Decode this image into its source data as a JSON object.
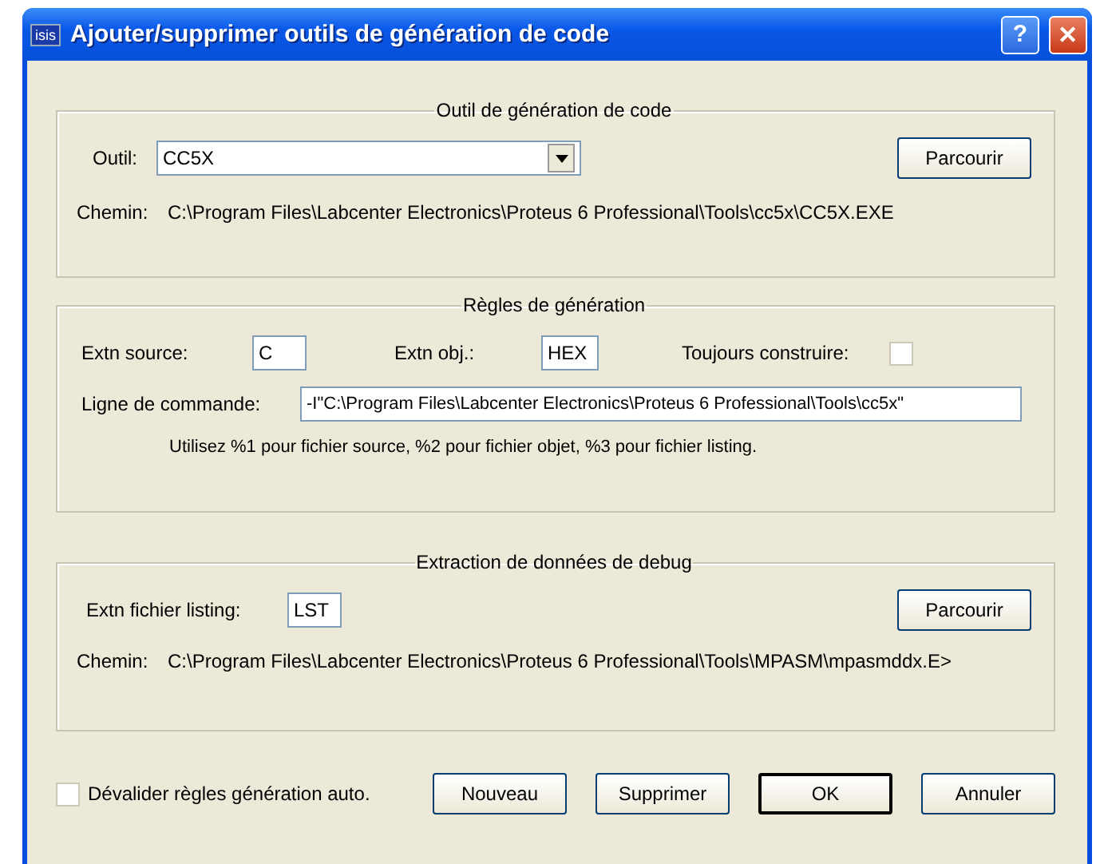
{
  "window": {
    "title": "Ajouter/supprimer outils de génération de code",
    "app_badge": "isis",
    "help_button": "?",
    "close_button": "✕"
  },
  "tool_group": {
    "title": "Outil de génération de code",
    "tool_label": "Outil:",
    "tool_value": "CC5X",
    "browse_button": "Parcourir",
    "path_label": "Chemin:",
    "path_value": "C:\\Program Files\\Labcenter Electronics\\Proteus 6 Professional\\Tools\\cc5x\\CC5X.EXE"
  },
  "rules_group": {
    "title": "Règles de génération",
    "source_label": "Extn source:",
    "source_value": "C",
    "obj_label": "Extn obj.:",
    "obj_value": "HEX",
    "always_build_label": "Toujours construire:",
    "always_build_checked": false,
    "command_label": "Ligne de commande:",
    "command_value": "-I\"C:\\Program Files\\Labcenter Electronics\\Proteus 6 Professional\\Tools\\cc5x\"",
    "hint": "Utilisez %1 pour fichier source, %2 pour fichier objet, %3 pour fichier listing."
  },
  "debug_group": {
    "title": "Extraction de données de debug",
    "listing_label": "Extn fichier listing:",
    "listing_value": "LST",
    "browse_button": "Parcourir",
    "path_label": "Chemin:",
    "path_value": "C:\\Program Files\\Labcenter Electronics\\Proteus 6 Professional\\Tools\\MPASM\\mpasmddx.E>"
  },
  "footer": {
    "disable_label": "Dévalider règles génération auto.",
    "disable_checked": false,
    "buttons": [
      {
        "label": "Nouveau",
        "default": false
      },
      {
        "label": "Supprimer",
        "default": false
      },
      {
        "label": "OK",
        "default": true
      },
      {
        "label": "Annuler",
        "default": false
      }
    ]
  }
}
